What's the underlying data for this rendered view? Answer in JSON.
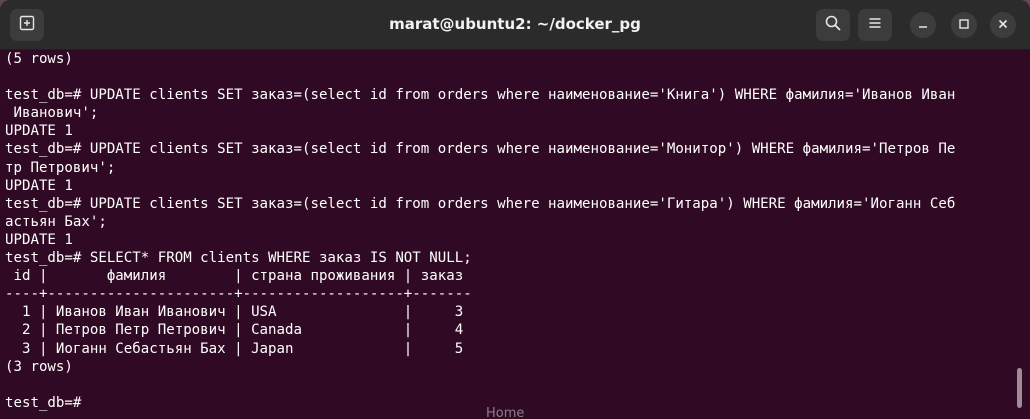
{
  "window": {
    "title": "marat@ubuntu2: ~/docker_pg"
  },
  "titlebar": {
    "icons": [
      "new-tab-icon",
      "search-icon",
      "hamburger-menu-icon",
      "minimize-icon",
      "maximize-icon",
      "close-icon"
    ]
  },
  "colors": {
    "terminal_background": "#300a24",
    "titlebar_background": "#2b2b2b",
    "text": "#ffffff"
  },
  "terminal": {
    "lines": [
      "(5 rows)",
      "",
      "test_db=# UPDATE clients SET заказ=(select id from orders where наименование='Книга') WHERE фамилия='Иванов Иван",
      " Иванович';",
      "UPDATE 1",
      "test_db=# UPDATE clients SET заказ=(select id from orders where наименование='Монитор') WHERE фамилия='Петров Пе",
      "тр Петрович';",
      "UPDATE 1",
      "test_db=# UPDATE clients SET заказ=(select id from orders where наименование='Гитара') WHERE фамилия='Иоганн Себ",
      "астьян Бах';",
      "UPDATE 1",
      "test_db=# SELECT* FROM clients WHERE заказ IS NOT NULL;",
      " id |       фамилия        | страна проживания | заказ",
      "----+----------------------+-------------------+-------",
      "  1 | Иванов Иван Иванович | USA               |     3",
      "  2 | Петров Петр Петрович | Canada            |     4",
      "  3 | Иоганн Себастьян Бах | Japan             |     5",
      "(3 rows)",
      "",
      "test_db=#"
    ]
  },
  "background_label": "Home"
}
